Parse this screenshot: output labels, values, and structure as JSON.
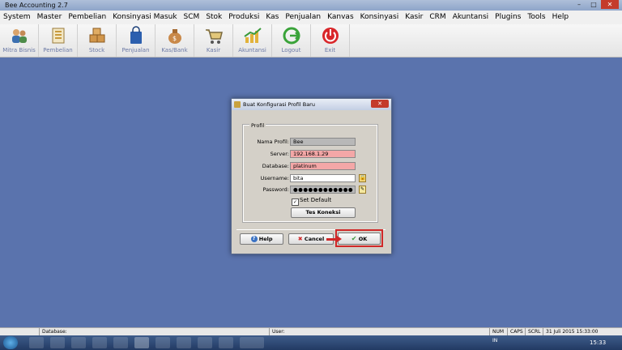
{
  "window": {
    "title": "Bee Accounting 2.7"
  },
  "menu": [
    "System",
    "Master",
    "Pembelian",
    "Konsinyasi Masuk",
    "SCM",
    "Stok",
    "Produksi",
    "Kas",
    "Penjualan",
    "Kanvas",
    "Konsinyasi",
    "Kasir",
    "CRM",
    "Akuntansi",
    "Plugins",
    "Tools",
    "Help"
  ],
  "toolbar": [
    "Mitra Bisnis",
    "Pembelian",
    "Stock",
    "Penjualan",
    "Kas/Bank",
    "Kasir",
    "Akuntansi",
    "Logout",
    "Exit"
  ],
  "dialog": {
    "title": "Buat Konfigurasi Profil Baru",
    "group_label": "Profil",
    "fields": {
      "nama_profil": {
        "label": "Nama Profil:",
        "value": "Bee"
      },
      "server": {
        "label": "Server:",
        "value": "192.168.1.29"
      },
      "database": {
        "label": "Database:",
        "value": "platinum"
      },
      "username": {
        "label": "Username:",
        "value": "bita"
      },
      "password": {
        "label": "Password:",
        "value": "●●●●●●●●●●●●"
      }
    },
    "set_default": "Set Default",
    "tes_koneksi": "Tes Koneksi",
    "help": "Help",
    "cancel": "Cancel",
    "ok": "OK"
  },
  "statusbar": {
    "database": "Database:",
    "user": "User:",
    "num": "NUM",
    "caps": "CAPS",
    "scrl": "SCRL",
    "datetime": "31 Juli 2015  15:33:00"
  },
  "taskbar": {
    "lang": "IN",
    "clock": "15:33"
  }
}
